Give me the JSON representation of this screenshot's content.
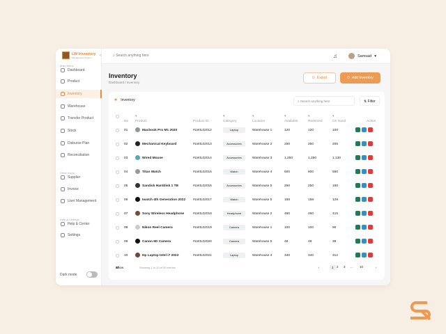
{
  "app": {
    "name": "LW Inventory",
    "tagline": "Management System"
  },
  "sidebar": {
    "sections": [
      "Main Menu",
      "Other menu",
      "Help & Settings"
    ],
    "items": [
      {
        "label": "Dashboard",
        "icon": "grid-icon"
      },
      {
        "label": "Product",
        "icon": "box-icon"
      },
      {
        "label": "Inventory",
        "icon": "inventory-icon",
        "active": true
      },
      {
        "label": "Warehouse",
        "icon": "warehouse-icon"
      },
      {
        "label": "Transfer Product",
        "icon": "transfer-icon"
      },
      {
        "label": "Stock",
        "icon": "stock-icon"
      },
      {
        "label": "Disburse Plan",
        "icon": "plan-icon"
      },
      {
        "label": "Reconciliation",
        "icon": "reconcile-icon"
      },
      {
        "label": "Supplier",
        "icon": "supplier-icon"
      },
      {
        "label": "Invoice",
        "icon": "invoice-icon"
      },
      {
        "label": "User Management",
        "icon": "users-icon"
      },
      {
        "label": "Help & Center",
        "icon": "help-icon"
      },
      {
        "label": "Settings",
        "icon": "gear-icon"
      }
    ],
    "dark_mode": "Dark mode",
    "dark_mode_on": false
  },
  "topbar": {
    "search_placeholder": "Search anything here",
    "user": "Samsad"
  },
  "page": {
    "title": "Inventory",
    "breadcrumb": "Dashboard / Inventory",
    "export": "Export",
    "add": "Add Inventory"
  },
  "card": {
    "title": "Inventory",
    "search_placeholder": "Search anything here",
    "filter": "Filter"
  },
  "table": {
    "headers": [
      "No",
      "Product",
      "Product ID",
      "Category",
      "Location",
      "Available",
      "Reserved",
      "On Hand",
      "Action"
    ],
    "rows": [
      [
        "01",
        "Macbook Pro M1 2020",
        "#LWIL02012",
        "Laptop",
        "Warehouse 1",
        "120",
        "120",
        "100"
      ],
      [
        "02",
        "Mechanical Keyboard",
        "#LWIL02013",
        "Accessories",
        "Warehouse 2",
        "250",
        "250",
        "205"
      ],
      [
        "03",
        "Wired Mouse",
        "#LWIL02014",
        "Accessories",
        "Warehouse 3",
        "1,250",
        "1,250",
        "1,130"
      ],
      [
        "04",
        "Titan Watch",
        "#LWIL02015",
        "Watch",
        "Warehouse 4",
        "600",
        "600",
        "560"
      ],
      [
        "05",
        "Sandisk Harddisk 1 TB",
        "#LWIL02016",
        "Accessories",
        "Warehouse 5",
        "250",
        "250",
        "190"
      ],
      [
        "06",
        "Iwatch 4th Generation 2022",
        "#LWIL02017",
        "Watch",
        "Warehouse 5",
        "158",
        "158",
        "128"
      ],
      [
        "07",
        "Sony Wireless Headphone",
        "#LWIL02018",
        "Headphone",
        "Warehouse 2",
        "460",
        "460",
        "415"
      ],
      [
        "08",
        "Nikon Reel Camera",
        "#LWIL02019",
        "Camera",
        "Warehouse 1",
        "100",
        "100",
        "90"
      ],
      [
        "09",
        "Canon 6D Camera",
        "#LWIL02020",
        "Camera",
        "Warehouse 5",
        "48",
        "48",
        "38"
      ],
      [
        "10",
        "Hp Laptop Intel i7 2023",
        "#LWIL02021",
        "Laptop",
        "Warehouse 4",
        "340",
        "340",
        "312"
      ]
    ]
  },
  "footer": {
    "show": "Show",
    "per_page": "10",
    "showing": "Showing 1 to 10 of 50 entries",
    "pages": [
      "1",
      "2",
      "3",
      "...",
      "10"
    ]
  },
  "colors": {
    "accent": "#e88a3a",
    "view": "#1f7a5a",
    "edit": "#2196d3",
    "delete": "#e53935"
  }
}
